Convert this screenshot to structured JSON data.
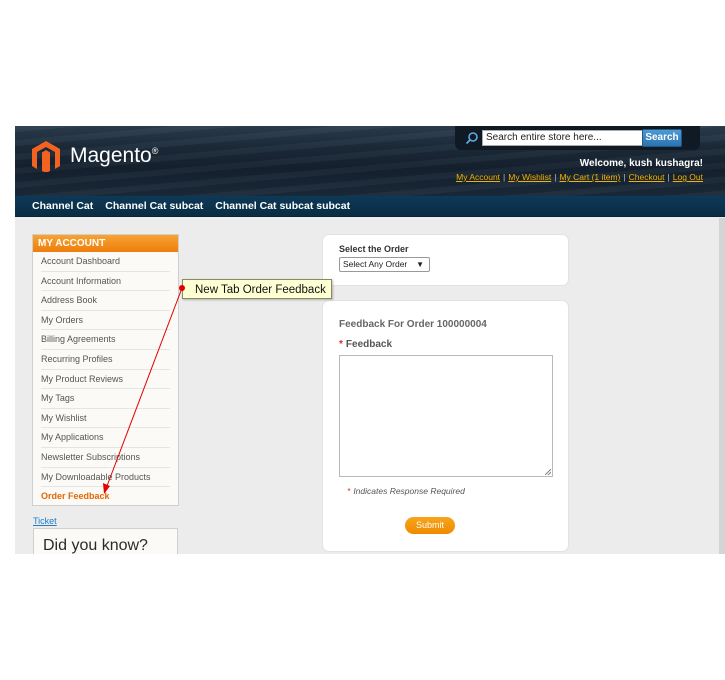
{
  "header": {
    "logo_text": "Magento",
    "logo_reg": "®",
    "search_placeholder": "Search entire store here...",
    "search_button": "Search",
    "welcome": "Welcome, kush kushagra!",
    "links": [
      "My Account",
      "My Wishlist",
      "My Cart (1 item)",
      "Checkout",
      "Log Out"
    ],
    "link_separator": "|"
  },
  "nav": {
    "items": [
      "Channel Cat",
      "Channel Cat subcat",
      "Channel Cat subcat subcat"
    ]
  },
  "sidebar": {
    "title": "MY ACCOUNT",
    "items": [
      "Account Dashboard",
      "Account Information",
      "Address Book",
      "My Orders",
      "Billing Agreements",
      "Recurring Profiles",
      "My Product Reviews",
      "My Tags",
      "My Wishlist",
      "My Applications",
      "Newsletter Subscriptions",
      "My Downloadable Products",
      "Order Feedback"
    ],
    "active_index": 12
  },
  "ticket_link": "Ticket",
  "did_you_know": "Did you know?",
  "order_panel": {
    "label": "Select the Order",
    "select_value": "Select Any Order"
  },
  "feedback_panel": {
    "title": "Feedback For Order 100000004",
    "required_mark": "*",
    "feedback_label": "Feedback",
    "required_note": "Indicates Response Required",
    "submit_label": "Submit"
  },
  "callout": {
    "text": "New Tab Order Feedback"
  },
  "colors": {
    "accent_orange": "#ee7d0c",
    "link_yellow": "#f2b300",
    "annotation_red": "#e00000"
  }
}
